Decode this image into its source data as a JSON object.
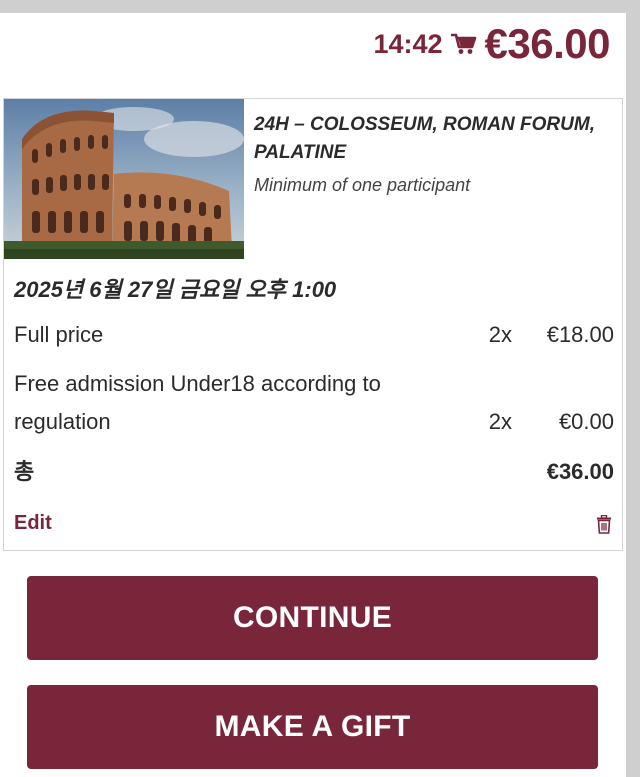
{
  "header": {
    "timer": "14:42",
    "cart_icon": "shopping-cart-icon",
    "total": "€36.00"
  },
  "item": {
    "title": "24h – COLOSSEUM, ROMAN FORUM, PALATINE",
    "subtitle": "Minimum of one participant",
    "image": "colosseum-photo",
    "date": "2025년 6월 27일 금요일 오후 1:00",
    "lines": [
      {
        "label": "Full price",
        "qty": "2x",
        "amount": "€18.00"
      },
      {
        "label": "Free admission Under18 according to regulation",
        "qty": "2x",
        "amount": "€0.00"
      }
    ],
    "total_label": "총",
    "total_amount": "€36.00",
    "edit_label": "Edit",
    "delete_icon": "trash-icon"
  },
  "actions": {
    "continue_label": "CONTINUE",
    "gift_label": "MAKE A GIFT"
  },
  "colors": {
    "accent": "#7a263a",
    "panel_background": "#ffffff",
    "page_background": "#cfcfcf"
  }
}
